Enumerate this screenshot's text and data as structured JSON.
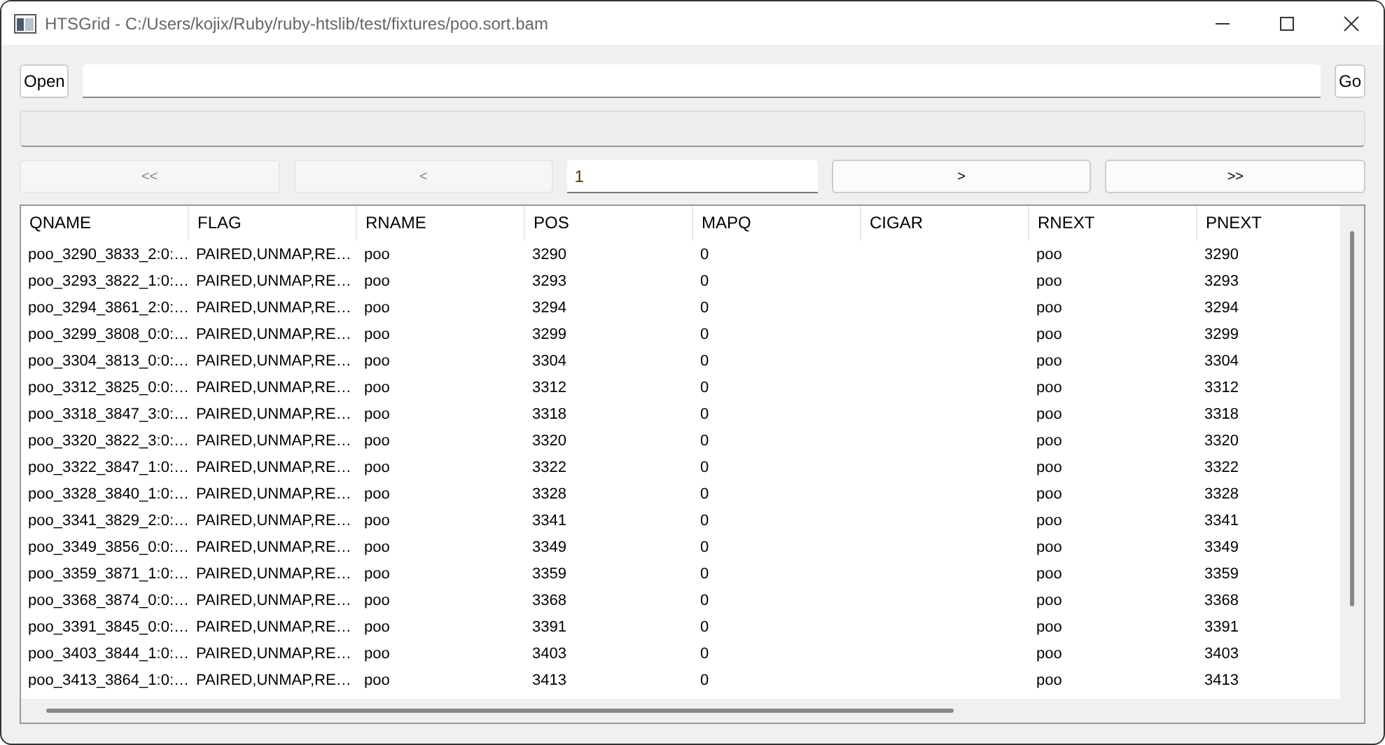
{
  "window": {
    "title": "HTSGrid - C:/Users/kojix/Ruby/ruby-htslib/test/fixtures/poo.sort.bam"
  },
  "toolbar": {
    "open_button": "Open",
    "go_button": "Go"
  },
  "progress": {
    "level": 0
  },
  "pager": {
    "first": "<<",
    "prev": "<",
    "page": "1",
    "next": ">",
    "last": ">>"
  },
  "table": {
    "columns": [
      "QNAME",
      "FLAG",
      "RNAME",
      "POS",
      "MAPQ",
      "CIGAR",
      "RNEXT",
      "PNEXT"
    ],
    "rows": [
      [
        "poo_3290_3833_2:0:…",
        "PAIRED,UNMAP,RE…",
        "poo",
        "3290",
        "0",
        null,
        "poo",
        "3290"
      ],
      [
        "poo_3293_3822_1:0:…",
        "PAIRED,UNMAP,RE…",
        "poo",
        "3293",
        "0",
        null,
        "poo",
        "3293"
      ],
      [
        "poo_3294_3861_2:0:…",
        "PAIRED,UNMAP,RE…",
        "poo",
        "3294",
        "0",
        null,
        "poo",
        "3294"
      ],
      [
        "poo_3299_3808_0:0:…",
        "PAIRED,UNMAP,RE…",
        "poo",
        "3299",
        "0",
        null,
        "poo",
        "3299"
      ],
      [
        "poo_3304_3813_0:0:…",
        "PAIRED,UNMAP,RE…",
        "poo",
        "3304",
        "0",
        null,
        "poo",
        "3304"
      ],
      [
        "poo_3312_3825_0:0:…",
        "PAIRED,UNMAP,RE…",
        "poo",
        "3312",
        "0",
        null,
        "poo",
        "3312"
      ],
      [
        "poo_3318_3847_3:0:…",
        "PAIRED,UNMAP,RE…",
        "poo",
        "3318",
        "0",
        null,
        "poo",
        "3318"
      ],
      [
        "poo_3320_3822_3:0:…",
        "PAIRED,UNMAP,RE…",
        "poo",
        "3320",
        "0",
        null,
        "poo",
        "3320"
      ],
      [
        "poo_3322_3847_1:0:…",
        "PAIRED,UNMAP,RE…",
        "poo",
        "3322",
        "0",
        null,
        "poo",
        "3322"
      ],
      [
        "poo_3328_3840_1:0:…",
        "PAIRED,UNMAP,RE…",
        "poo",
        "3328",
        "0",
        null,
        "poo",
        "3328"
      ],
      [
        "poo_3341_3829_2:0:…",
        "PAIRED,UNMAP,RE…",
        "poo",
        "3341",
        "0",
        null,
        "poo",
        "3341"
      ],
      [
        "poo_3349_3856_0:0:…",
        "PAIRED,UNMAP,RE…",
        "poo",
        "3349",
        "0",
        null,
        "poo",
        "3349"
      ],
      [
        "poo_3359_3871_1:0:…",
        "PAIRED,UNMAP,RE…",
        "poo",
        "3359",
        "0",
        null,
        "poo",
        "3359"
      ],
      [
        "poo_3368_3874_0:0:…",
        "PAIRED,UNMAP,RE…",
        "poo",
        "3368",
        "0",
        null,
        "poo",
        "3368"
      ],
      [
        "poo_3391_3845_0:0:…",
        "PAIRED,UNMAP,RE…",
        "poo",
        "3391",
        "0",
        null,
        "poo",
        "3391"
      ],
      [
        "poo_3403_3844_1:0:…",
        "PAIRED,UNMAP,RE…",
        "poo",
        "3403",
        "0",
        null,
        "poo",
        "3403"
      ],
      [
        "poo_3413_3864_1:0:…",
        "PAIRED,UNMAP,RE…",
        "poo",
        "3413",
        "0",
        null,
        "poo",
        "3413"
      ]
    ]
  }
}
